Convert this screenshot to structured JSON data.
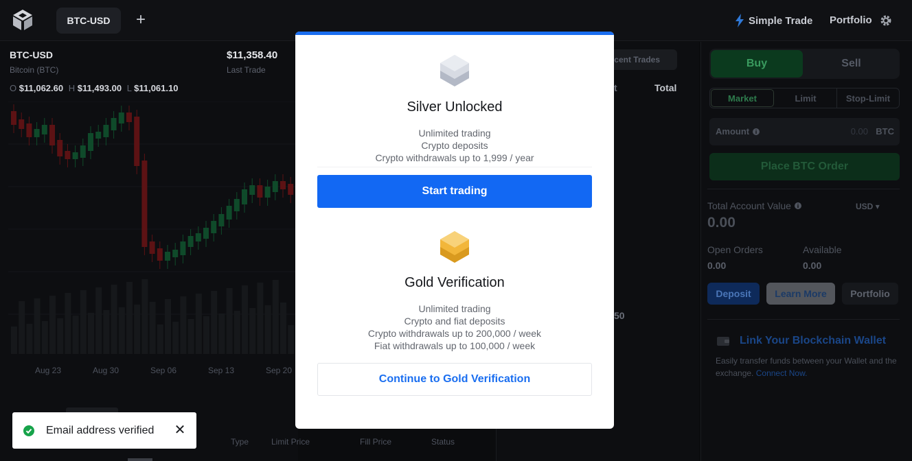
{
  "header": {
    "pair_tab": "BTC-USD",
    "add_icon": "plus-icon",
    "simple_trade": "Simple Trade",
    "portfolio": "Portfolio"
  },
  "market": {
    "symbol": "BTC-USD",
    "name": "Bitcoin (BTC)",
    "last_price": "$11,358.40",
    "last_label": "Last Trade",
    "open_label": "O",
    "open": "$11,062.60",
    "high_label": "H",
    "high": "$11,493.00",
    "low_label": "L",
    "low": "$11,061.10",
    "dates": [
      "Aug 23",
      "Aug 30",
      "Sep 06",
      "Sep 13",
      "Sep 20"
    ]
  },
  "orders_table": {
    "columns": [
      "Type",
      "Limit Price",
      "Fill Price",
      "Status"
    ]
  },
  "mid": {
    "recent_trades": "cent Trades",
    "col_partial": "t",
    "total": "Total",
    "price_partial": "50"
  },
  "trade_panel": {
    "buy": "Buy",
    "sell": "Sell",
    "order_types": [
      "Market",
      "Limit",
      "Stop-Limit"
    ],
    "amount_label": "Amount",
    "amount_value": "0.00",
    "amount_currency": "BTC",
    "place_order": "Place BTC Order",
    "total_account_label": "Total Account Value",
    "total_account_value": "0.00",
    "currency_select": "USD",
    "open_orders_label": "Open Orders",
    "open_orders_value": "0.00",
    "available_label": "Available",
    "available_value": "0.00",
    "deposit": "Deposit",
    "learn_more": "Learn More",
    "portfolio": "Portfolio",
    "wallet_title": "Link Your Blockchain Wallet",
    "wallet_desc": "Easily transfer funds between your Wallet and the exchange.",
    "wallet_link": "Connect Now."
  },
  "modal": {
    "silver_title": "Silver Unlocked",
    "silver_features": [
      "Unlimited trading",
      "Crypto deposits",
      "Crypto withdrawals up to 1,999 / year"
    ],
    "start_trading": "Start trading",
    "gold_title": "Gold Verification",
    "gold_features": [
      "Unlimited trading",
      "Crypto and fiat deposits",
      "Crypto withdrawals up to 200,000 / week",
      "Fiat withdrawals up to 100,000 / week"
    ],
    "continue_gold": "Continue to Gold Verification"
  },
  "toast": {
    "message": "Email address verified"
  },
  "colors": {
    "accent_blue": "#1268f3",
    "buy_green": "#0b3a1e",
    "silver": "#c6cad4",
    "gold": "#f2b63a"
  }
}
